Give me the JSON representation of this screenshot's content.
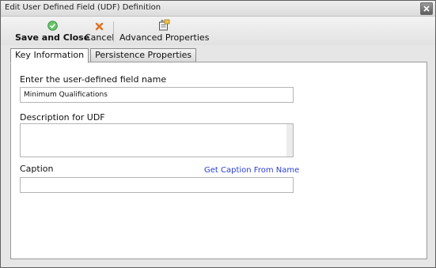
{
  "window": {
    "title": "Edit User Defined Field (UDF) Definition"
  },
  "toolbar": {
    "save_label": "Save and Close",
    "cancel_label": "Cancel",
    "advanced_label": "Advanced Properties"
  },
  "tabs": [
    {
      "label": "Key Information",
      "active": true
    },
    {
      "label": "Persistence Properties",
      "active": false
    }
  ],
  "form": {
    "name_label": "Enter the user-defined field name",
    "name_value": "Minimum Qualifications",
    "description_label": "Description for UDF",
    "description_value": "",
    "caption_label": "Caption",
    "caption_value": "",
    "caption_link": "Get Caption From Name"
  },
  "icons": {
    "save": "check-circle-icon",
    "cancel": "x-icon",
    "advanced": "properties-icon",
    "close": "close-icon"
  },
  "colors": {
    "link": "#2a3fd6",
    "save_icon": "#4caf50",
    "cancel_icon": "#e07020"
  }
}
